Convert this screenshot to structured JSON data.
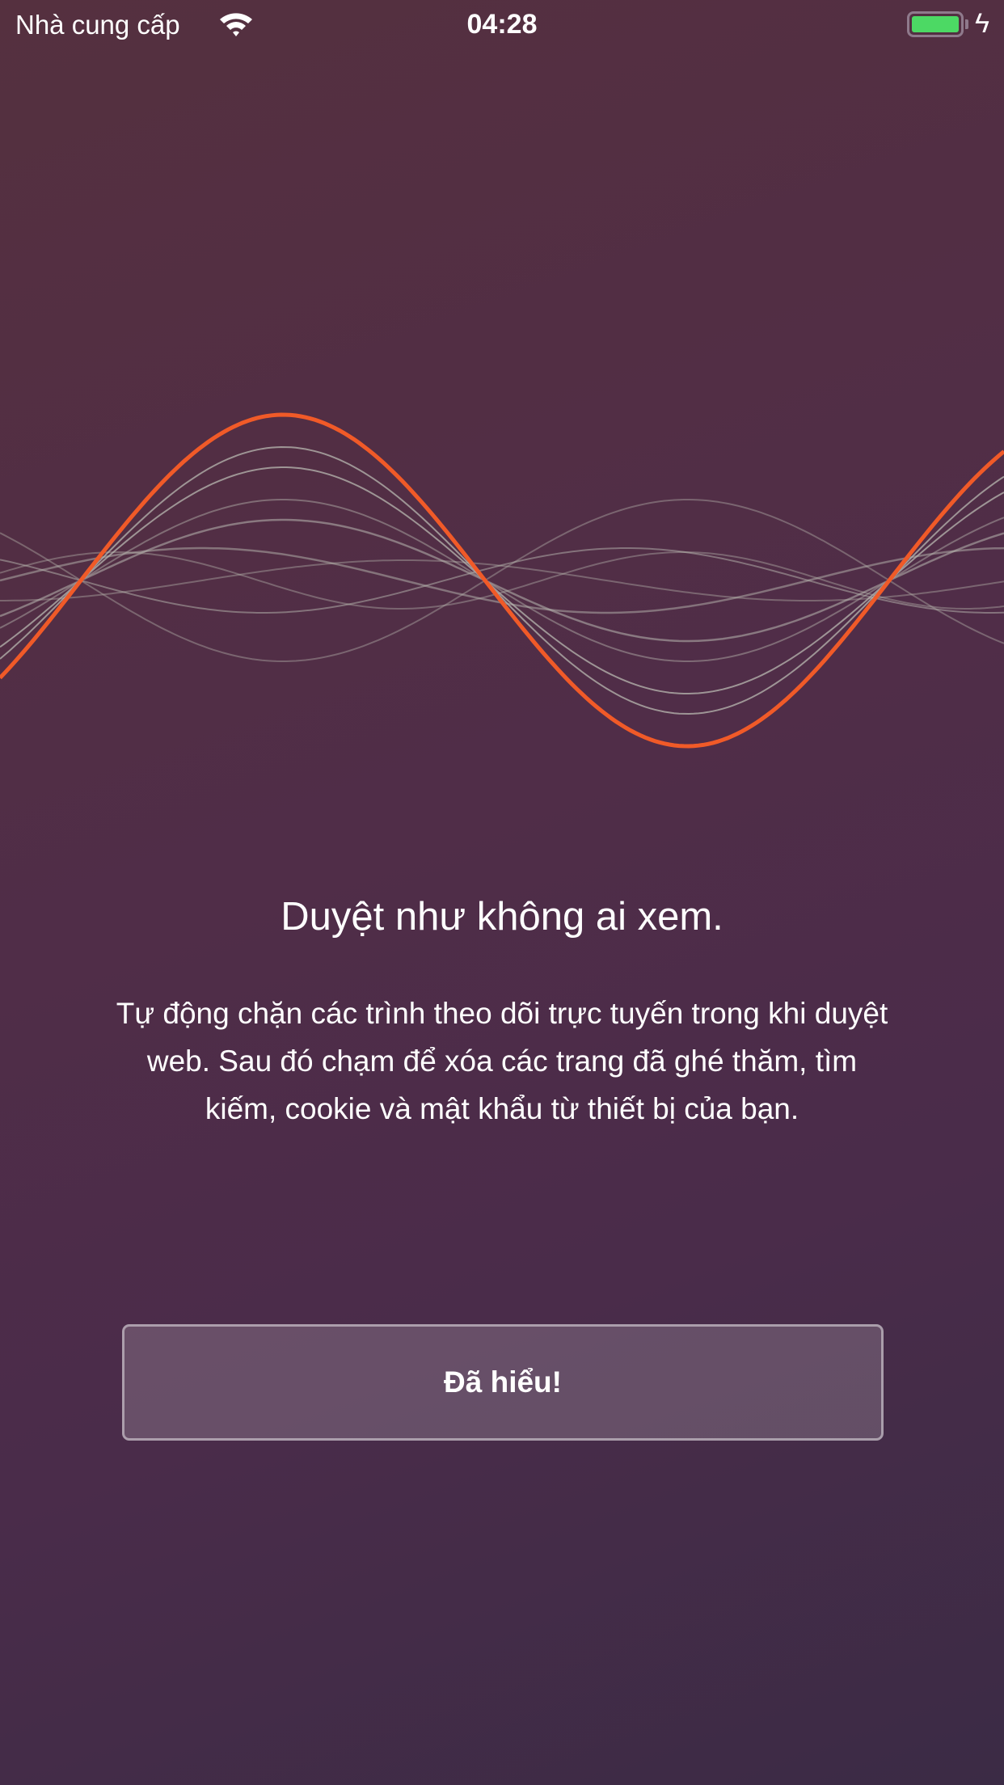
{
  "status_bar": {
    "carrier": "Nhà cung cấp",
    "time": "04:28",
    "battery_level": 1.0,
    "charging": true,
    "battery_color": "#4cd964"
  },
  "onboarding": {
    "title": "Duyệt như không ai xem.",
    "description": "Tự động chặn các trình theo dõi trực tuyến trong khi duyệt web. Sau đó chạm để xóa các trang đã ghé thăm, tìm kiếm, cookie và mật khẩu từ thiết bị của bạn.",
    "confirm_button": "Đã hiểu!"
  },
  "colors": {
    "accent_wave": "#f05a28",
    "background_top": "#55303f",
    "background_bottom": "#3b2b45"
  }
}
